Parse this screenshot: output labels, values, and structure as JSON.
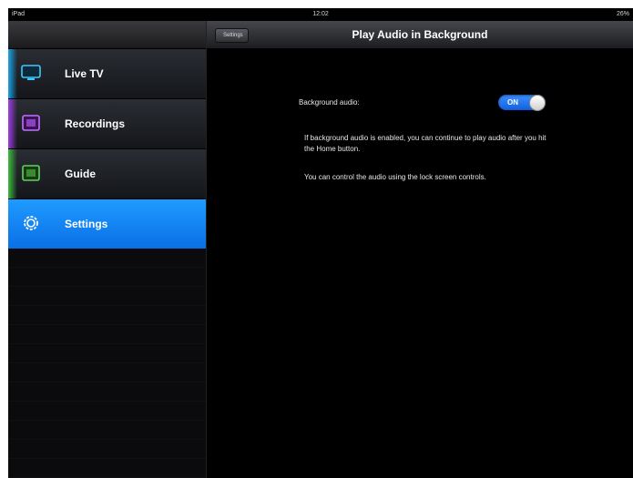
{
  "status_bar": {
    "carrier": "iPad",
    "time": "12:02",
    "battery": "26%"
  },
  "sidebar": {
    "items": [
      {
        "label": "Live TV",
        "icon": "tv-icon",
        "accent": "#18b4ff"
      },
      {
        "label": "Recordings",
        "icon": "recordings-icon",
        "accent": "#b040ff"
      },
      {
        "label": "Guide",
        "icon": "guide-icon",
        "accent": "#40d040"
      },
      {
        "label": "Settings",
        "icon": "gear-icon",
        "accent": "#ffffff",
        "active": true
      }
    ]
  },
  "navbar": {
    "back_label": "Settings",
    "title": "Play Audio in Background"
  },
  "setting": {
    "label": "Background audio:",
    "toggle_state": "ON",
    "toggle_color": "#1a73ff"
  },
  "descriptions": [
    "If background audio is enabled, you can continue to play audio after you hit the Home button.",
    "You can control the audio using the lock screen controls."
  ]
}
